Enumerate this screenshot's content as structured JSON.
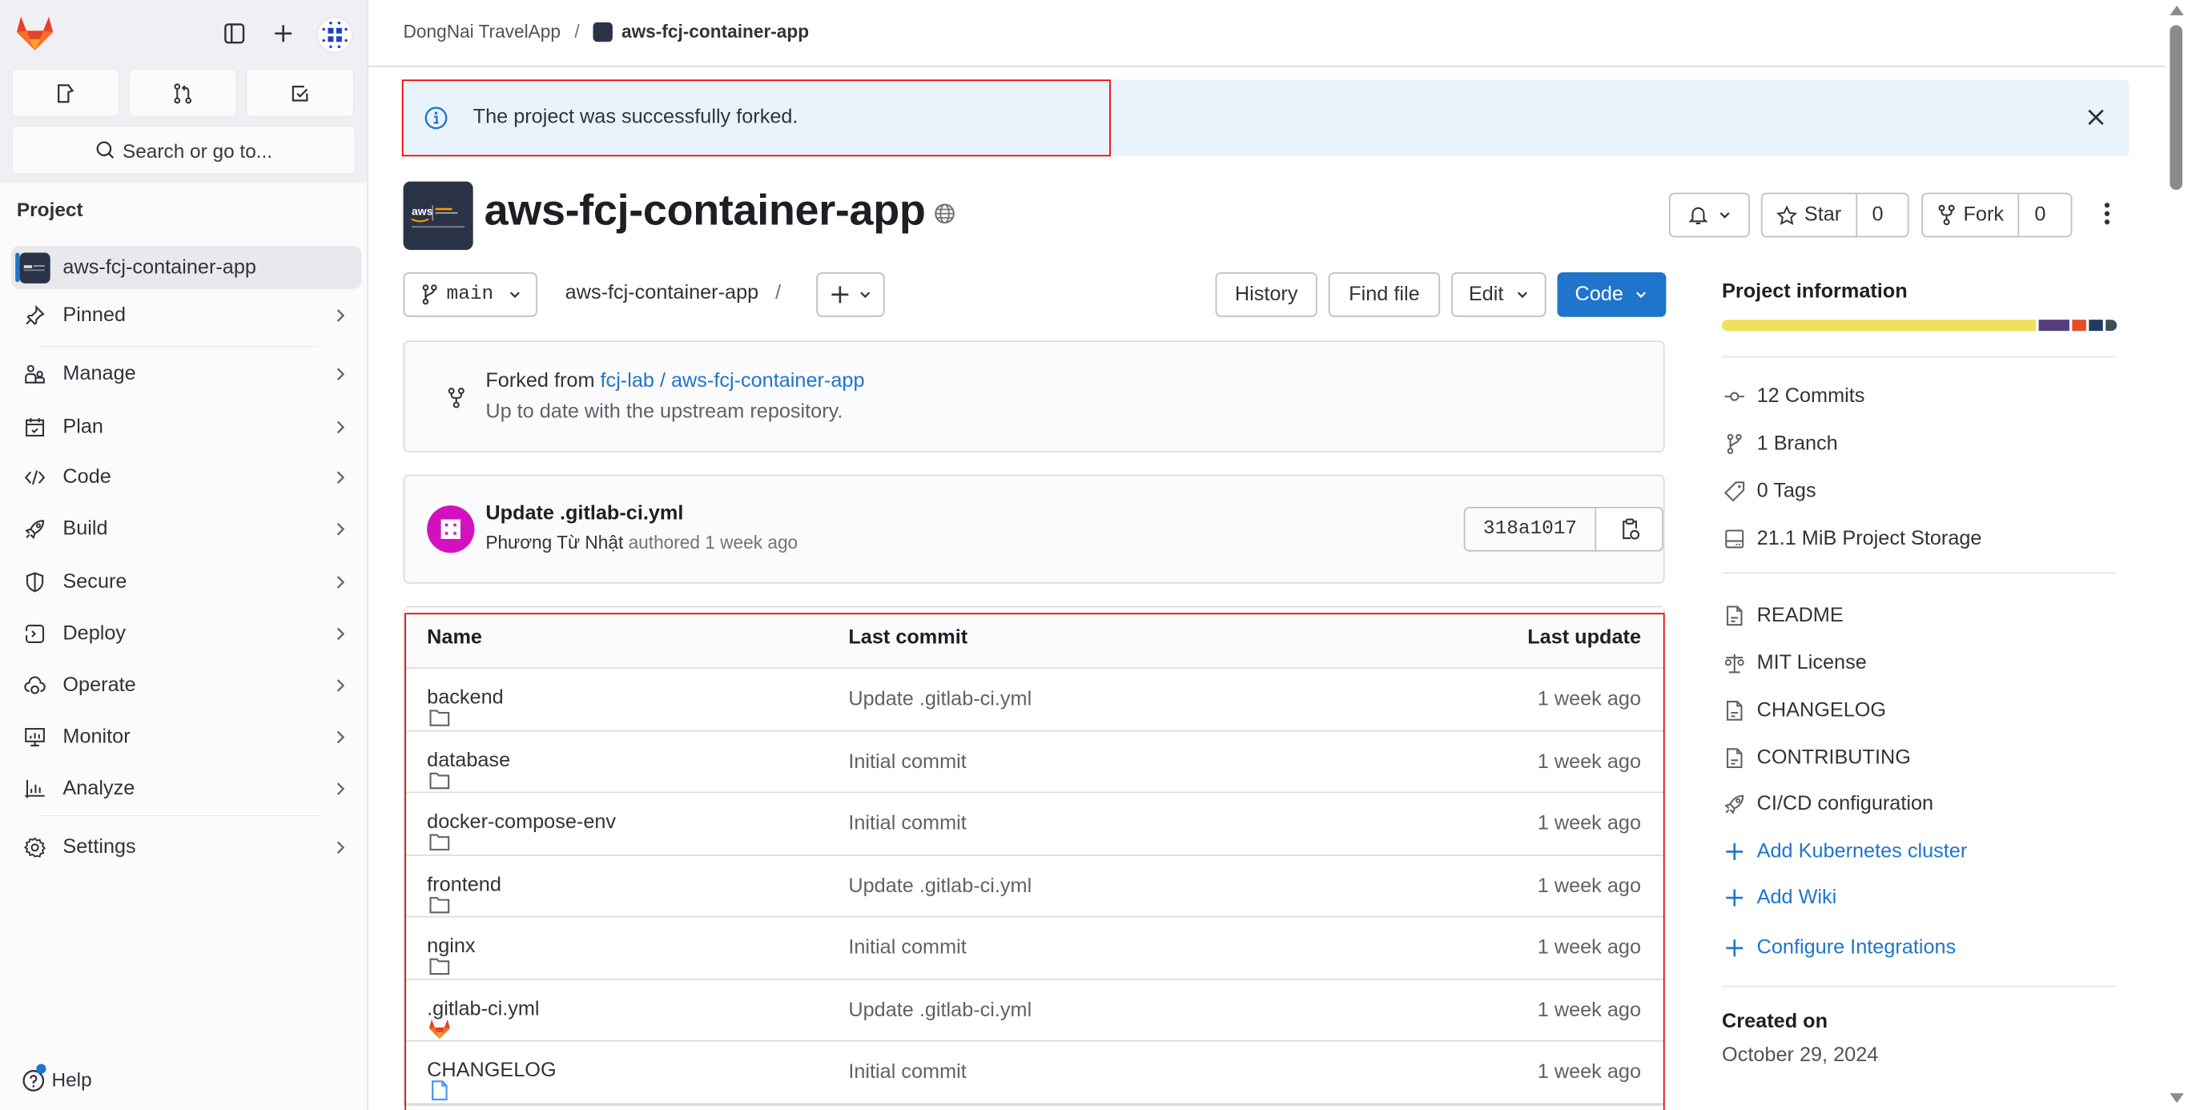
{
  "sidebar": {
    "search_placeholder": "Search or go to...",
    "section_label": "Project",
    "project_item": "aws-fcj-container-app",
    "items": [
      {
        "label": "Pinned",
        "icon": "pin-icon"
      },
      {
        "label": "Manage",
        "icon": "users-icon"
      },
      {
        "label": "Plan",
        "icon": "calendar-icon"
      },
      {
        "label": "Code",
        "icon": "code-icon"
      },
      {
        "label": "Build",
        "icon": "rocket-icon"
      },
      {
        "label": "Secure",
        "icon": "shield-icon"
      },
      {
        "label": "Deploy",
        "icon": "deploy-icon"
      },
      {
        "label": "Operate",
        "icon": "cloud-gear-icon"
      },
      {
        "label": "Monitor",
        "icon": "monitor-icon"
      },
      {
        "label": "Analyze",
        "icon": "chart-icon"
      },
      {
        "label": "Settings",
        "icon": "gear-icon"
      }
    ],
    "help_label": "Help"
  },
  "breadcrumb": {
    "group": "DongNai TravelApp",
    "separator": "/",
    "project": "aws-fcj-container-app"
  },
  "alert": {
    "message": "The project was successfully forked."
  },
  "project": {
    "title": "aws-fcj-container-app",
    "visibility_icon": "globe-icon",
    "star_label": "Star",
    "star_count": "0",
    "fork_label": "Fork",
    "fork_count": "0"
  },
  "repo_toolbar": {
    "branch": "main",
    "path": "aws-fcj-container-app",
    "path_sep": "/",
    "history": "History",
    "find_file": "Find file",
    "edit": "Edit",
    "code": "Code"
  },
  "fork_info": {
    "prefix": "Forked from ",
    "source": "fcj-lab / aws-fcj-container-app",
    "status": "Up to date with the upstream repository."
  },
  "last_commit": {
    "title": "Update .gitlab-ci.yml",
    "author": "Phương Từ Nhật",
    "meta": " authored 1 week ago",
    "sha": "318a1017"
  },
  "file_table": {
    "headers": [
      "Name",
      "Last commit",
      "Last update"
    ],
    "rows": [
      {
        "name": "backend",
        "type": "folder",
        "commit": "Update .gitlab-ci.yml",
        "updated": "1 week ago"
      },
      {
        "name": "database",
        "type": "folder",
        "commit": "Initial commit",
        "updated": "1 week ago"
      },
      {
        "name": "docker-compose-env",
        "type": "folder",
        "commit": "Initial commit",
        "updated": "1 week ago"
      },
      {
        "name": "frontend",
        "type": "folder",
        "commit": "Update .gitlab-ci.yml",
        "updated": "1 week ago"
      },
      {
        "name": "nginx",
        "type": "folder",
        "commit": "Initial commit",
        "updated": "1 week ago"
      },
      {
        "name": ".gitlab-ci.yml",
        "type": "gitlab",
        "commit": "Update .gitlab-ci.yml",
        "updated": "1 week ago"
      },
      {
        "name": "CHANGELOG",
        "type": "file",
        "commit": "Initial commit",
        "updated": "1 week ago"
      }
    ]
  },
  "project_info": {
    "title": "Project information",
    "languages": [
      {
        "color": "#f1e05a",
        "percent": 81
      },
      {
        "color": "#563d7c",
        "percent": 8
      },
      {
        "color": "#e34c26",
        "percent": 3.5
      },
      {
        "color": "#1f3a5f",
        "percent": 3.5
      },
      {
        "color": "#384d54",
        "percent": 3
      }
    ],
    "stats": [
      {
        "label": "12 Commits",
        "icon": "commit-icon"
      },
      {
        "label": "1 Branch",
        "icon": "branch-icon"
      },
      {
        "label": "0 Tags",
        "icon": "tag-icon"
      },
      {
        "label": "21.1 MiB Project Storage",
        "icon": "storage-icon"
      }
    ],
    "files": [
      {
        "label": "README",
        "icon": "doc-icon"
      },
      {
        "label": "MIT License",
        "icon": "scale-icon"
      },
      {
        "label": "CHANGELOG",
        "icon": "doc-icon"
      },
      {
        "label": "CONTRIBUTING",
        "icon": "doc-icon"
      },
      {
        "label": "CI/CD configuration",
        "icon": "rocket-icon"
      }
    ],
    "actions": [
      {
        "label": "Add Kubernetes cluster"
      },
      {
        "label": "Add Wiki"
      },
      {
        "label": "Configure Integrations"
      }
    ],
    "created_label": "Created on",
    "created_value": "October 29, 2024"
  },
  "colors": {
    "accent": "#1f75cb",
    "alert_bg": "#e9f3fc",
    "annotation_outline": "#ee0000"
  }
}
